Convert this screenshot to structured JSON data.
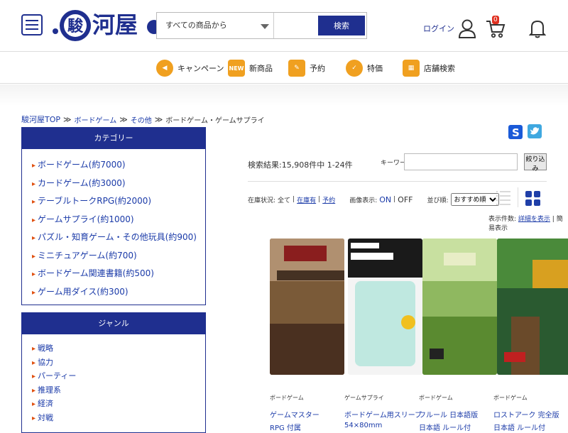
{
  "header": {
    "search_category": "すべての商品から",
    "search_placeholder": "",
    "search_button": "検索",
    "login_label": "ログイン",
    "cart_count": "0"
  },
  "nav": [
    {
      "label": "キャンペーン",
      "icon": "megaphone-icon"
    },
    {
      "label": "新商品",
      "icon": "new-badge-icon"
    },
    {
      "label": "予約",
      "icon": "reserve-icon"
    },
    {
      "label": "特価",
      "icon": "check-badge-icon"
    },
    {
      "label": "店舗検索",
      "icon": "store-icon"
    }
  ],
  "breadcrumb": {
    "top": "駿河屋TOP",
    "level1": "ボードゲーム",
    "level2": "その他",
    "current": "ボードゲーム・ゲームサプライ"
  },
  "sidebar": {
    "categories_title": "カテゴリー",
    "categories": [
      "ボードゲーム(約7000)",
      "カードゲーム(約3000)",
      "テーブルトークRPG(約2000)",
      "ゲームサプライ(約1000)",
      "パズル・知育ゲーム・その他玩具(約900)",
      "ミニチュアゲーム(約700)",
      "ボードゲーム関連書籍(約500)",
      "ゲーム用ダイス(約300)"
    ],
    "genre_title": "ジャンル",
    "genres": [
      "戦略",
      "協力",
      "パーティー",
      "推理系",
      "経済",
      "対戦"
    ]
  },
  "results": {
    "count_text": "検索結果:15,908件中 1-24件",
    "keyword_label": "キーワード:",
    "keyword_value": "",
    "keyword_button": "絞り込み",
    "stock_label": "在庫状況:",
    "stock_all": "全て",
    "stock_in": "在庫有",
    "stock_reserve": "予約",
    "image_label": "画像表示:",
    "image_on": "ON",
    "image_off": "OFF",
    "sort_label": "並び順:",
    "sort_value": "おすすめ順",
    "display_label": "表示件数:",
    "display_detail": "詳細を表示",
    "display_simple": "簡易表示"
  },
  "products": [
    {
      "label": "ボードゲーム",
      "name": "ゲームマスター",
      "sub": "RPG 付属"
    },
    {
      "label": "ゲームサプライ",
      "name": "ボードゲーム用スリーブ",
      "sub": "54×80mm"
    },
    {
      "label": "ボードゲーム",
      "name": "フルール 日本語版",
      "sub": "日本語 ルール付"
    },
    {
      "label": "ボードゲーム",
      "name": "ロストアーク 完全版",
      "sub": "日本語 ルール付"
    }
  ]
}
